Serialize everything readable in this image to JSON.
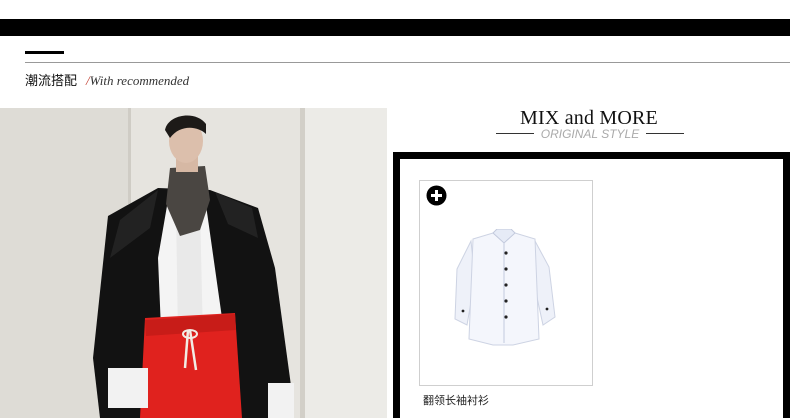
{
  "section": {
    "title_zh": "潮流搭配",
    "title_slash": "/",
    "title_en": "With recommended"
  },
  "mix": {
    "title": "MIX and MORE",
    "subtitle": "ORIGINAL STYLE"
  },
  "product": {
    "name": "翻领长袖衬衫",
    "add_icon": "plus-circle-icon"
  },
  "colors": {
    "bar": "#000000",
    "photo_bg": "#e7e5e0",
    "pants": "#e0221e",
    "subtitle": "#aaaaaa"
  }
}
